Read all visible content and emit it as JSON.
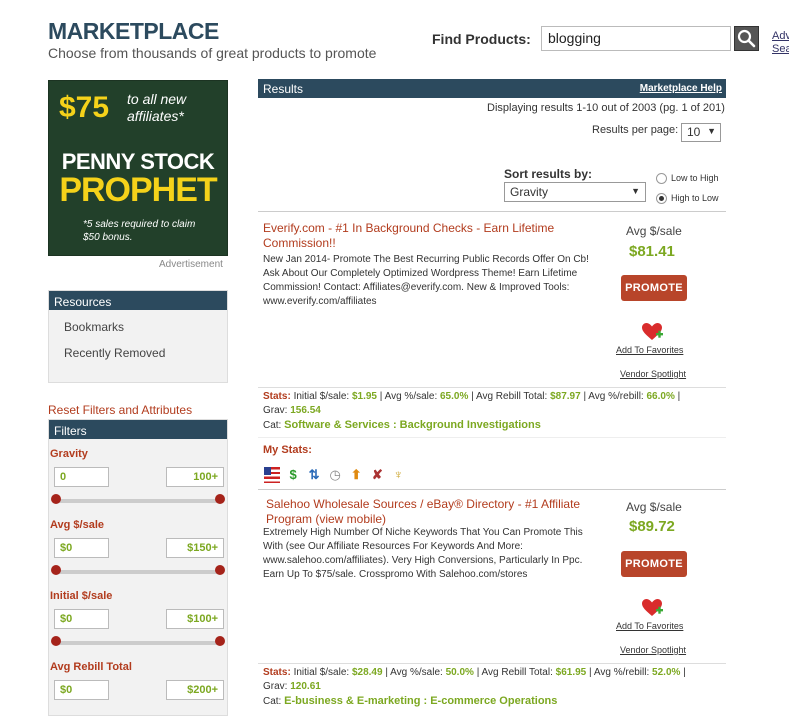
{
  "header": {
    "title": "MARKETPLACE",
    "subtitle": "Choose from thousands of great products to promote",
    "find_label": "Find Products:",
    "search_value": "blogging",
    "adv_link_1": "Adv",
    "adv_link_2": "Sea"
  },
  "ad": {
    "price": "$75",
    "tagline": "to all new affiliates*",
    "line1": "PENNY STOCK",
    "line2": "PROPHET",
    "note": "*5 sales required to claim $50 bonus.",
    "caption": "Advertisement"
  },
  "resources": {
    "title": "Resources",
    "items": [
      "Bookmarks",
      "Recently Removed"
    ]
  },
  "filters": {
    "reset_label": "Reset Filters and Attributes",
    "title": "Filters",
    "items": [
      {
        "label": "Gravity",
        "min": "0",
        "max": "100+"
      },
      {
        "label": "Avg $/sale",
        "min": "$0",
        "max": "$150+"
      },
      {
        "label": "Initial $/sale",
        "min": "$0",
        "max": "$100+"
      },
      {
        "label": "Avg Rebill Total",
        "min": "$0",
        "max": "$200+"
      }
    ]
  },
  "results": {
    "title": "Results",
    "help": "Marketplace Help",
    "displaying": "Displaying results 1-10 out of 2003 (pg. 1 of 201)",
    "per_page_label": "Results per page:",
    "per_page_value": "10",
    "sort_label": "Sort results by:",
    "sort_value": "Gravity",
    "low_to_high": "Low to High",
    "high_to_low": "High to Low"
  },
  "listings": [
    {
      "title": "Everify.com - #1 In Background Checks - Earn Lifetime Commission!!",
      "desc": "New Jan 2014- Promote The Best Recurring Public Records Offer On Cb! Ask About Our Completely Optimized Wordpress Theme! Earn Lifetime Commission! Contact: Affiliates@everify.com. New & Improved Tools: www.everify.com/affiliates",
      "avg_label": "Avg $/sale",
      "avg_value": "$81.41",
      "promote": "PROMOTE",
      "favorites": "Add To Favorites",
      "spotlight": "Vendor Spotlight",
      "stats_label": "Stats:",
      "initial": "$1.95",
      "avg_pct": "65.0%",
      "rebill_total": "$87.97",
      "rebill_pct": "66.0%",
      "grav": "156.54",
      "cat": "Software & Services : Background Investigations"
    },
    {
      "title": "Salehoo Wholesale Sources / eBay® Directory - #1 Affiliate Program (view mobile)",
      "desc": "Extremely High Number Of Niche Keywords That You Can Promote This With (see Our Affiliate Resources For Keywords And More: www.salehoo.com/affiliates). Very High Conversions, Particularly In Ppc. Earn Up To $75/sale. Crosspromo With Salehoo.com/stores",
      "avg_label": "Avg $/sale",
      "avg_value": "$89.72",
      "promote": "PROMOTE",
      "favorites": "Add To Favorites",
      "spotlight": "Vendor Spotlight",
      "stats_label": "Stats:",
      "initial": "$28.49",
      "avg_pct": "50.0%",
      "rebill_total": "$61.95",
      "rebill_pct": "52.0%",
      "grav": "120.61",
      "cat": "E-business & E-marketing : E-commerce Operations"
    }
  ],
  "stat_labels": {
    "initial": "Initial $/sale:",
    "avg_pct": "Avg %/sale:",
    "rebill_total": "Avg Rebill Total:",
    "rebill_pct": "Avg %/rebill:",
    "grav": "Grav:",
    "cat": "Cat:"
  },
  "mystats": "My Stats:",
  "icons": [
    "us-flag-icon",
    "dollar-icon",
    "exchange-icon",
    "clock-icon",
    "up-arrow-icon",
    "tools-icon",
    "lamp-icon"
  ]
}
